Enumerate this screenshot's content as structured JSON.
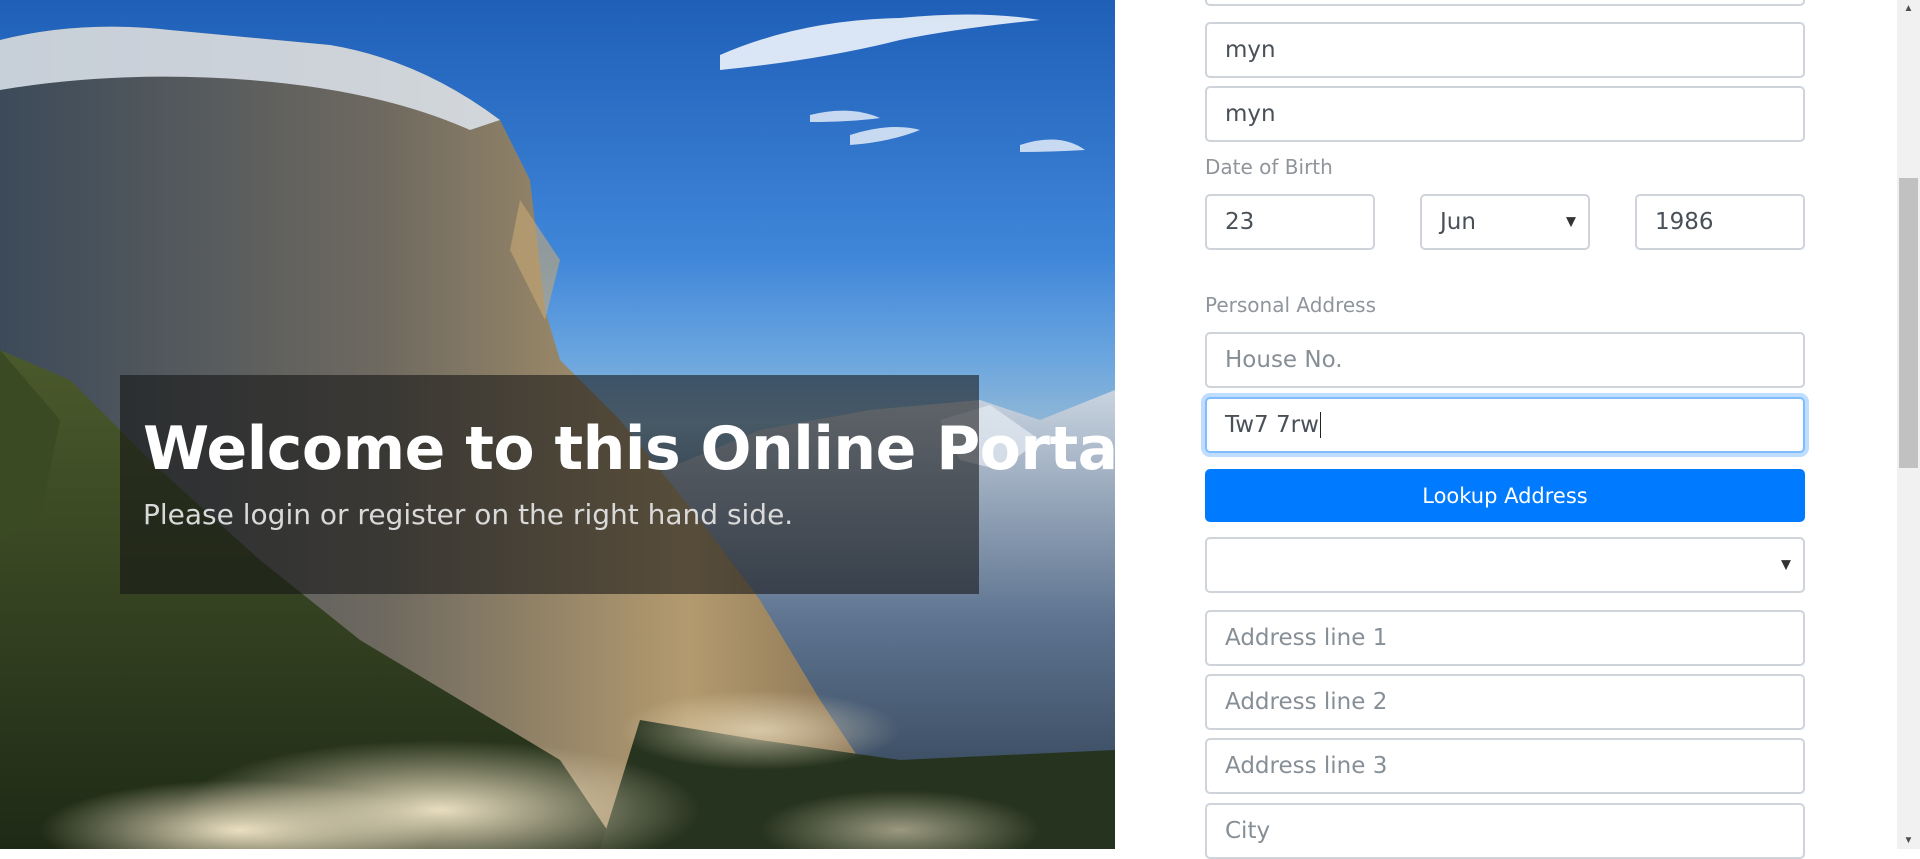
{
  "hero": {
    "title": "Welcome to this Online Portal",
    "subtitle": "Please login or register on the right hand side."
  },
  "form": {
    "first_name_value": "myn",
    "last_name_value": "myn",
    "dob_label": "Date of Birth",
    "dob_day_value": "23",
    "dob_month_value": "Jun",
    "dob_year_value": "1986",
    "address_label": "Personal Address",
    "house_no_placeholder": "House No.",
    "postcode_value": "Tw7 7rw",
    "lookup_button_label": "Lookup Address",
    "address_select_value": "",
    "address1_placeholder": "Address line 1",
    "address2_placeholder": "Address line 2",
    "address3_placeholder": "Address line 3",
    "city_placeholder": "City"
  },
  "icons": {
    "select_arrow": "caret-down-icon",
    "scroll_up": "scroll-up-icon",
    "scroll_down": "scroll-down-icon"
  },
  "colors": {
    "primary_button": "#007bff",
    "focus_border": "#80bdff"
  }
}
